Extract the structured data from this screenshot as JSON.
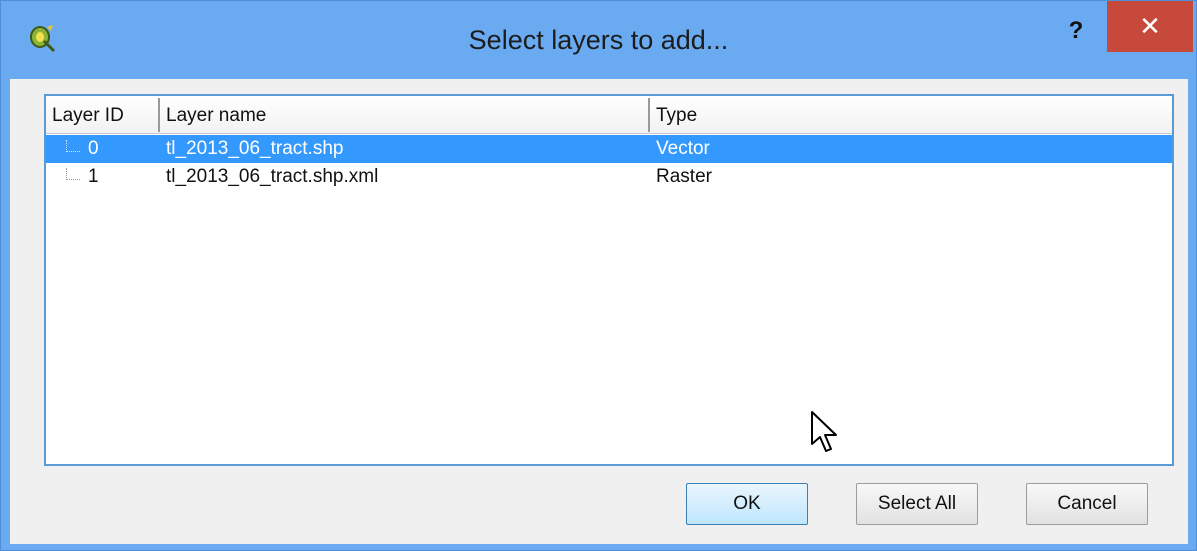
{
  "window": {
    "title": "Select layers to add...",
    "help_label": "?",
    "close_label": "✕",
    "app_icon": "qgis-logo-icon"
  },
  "table": {
    "columns": [
      "Layer ID",
      "Layer name",
      "Type"
    ],
    "rows": [
      {
        "id": "0",
        "name": "tl_2013_06_tract.shp",
        "type": "Vector",
        "selected": true
      },
      {
        "id": "1",
        "name": "tl_2013_06_tract.shp.xml",
        "type": "Raster",
        "selected": false
      }
    ]
  },
  "buttons": {
    "ok": "OK",
    "select_all": "Select All",
    "cancel": "Cancel"
  },
  "colors": {
    "titlebar": "#6aaaf1",
    "selection": "#3399ff",
    "close": "#c7493b"
  }
}
